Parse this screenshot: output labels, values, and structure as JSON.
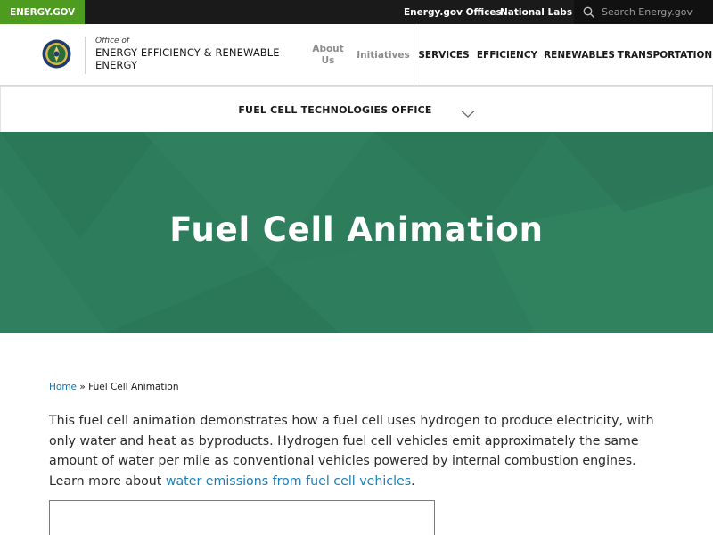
{
  "topbar": {
    "brand": "ENERGY.GOV",
    "offices_link": "Energy.gov Offices",
    "labs_link": "National Labs",
    "search_placeholder": "Search Energy.gov"
  },
  "header": {
    "office_of": "Office of",
    "site_name": "ENERGY EFFICIENCY & RENEWABLE ENERGY",
    "nav": [
      {
        "label": "About Us"
      },
      {
        "label": "Initiatives"
      },
      {
        "label": "SERVICES"
      },
      {
        "label": "EFFICIENCY"
      },
      {
        "label": "RENEWABLES"
      },
      {
        "label": "TRANSPORTATION"
      }
    ]
  },
  "subnav": {
    "label": "FUEL CELL TECHNOLOGIES OFFICE"
  },
  "hero": {
    "title": "Fuel Cell Animation"
  },
  "breadcrumb": {
    "home": "Home",
    "separator": "»",
    "current": "Fuel Cell Animation"
  },
  "intro": {
    "text": "This fuel cell animation demonstrates how a fuel cell uses hydrogen to produce electricity, with only water and heat as byproducts. Hydrogen fuel cell vehicles emit approximately the same amount of water per mile as conventional vehicles powered by internal combustion engines. Learn more about ",
    "link_text": "water emissions from fuel cell vehicles",
    "end": "."
  },
  "colors": {
    "brand_green": "#4d9b1f",
    "hero_green": "#2d7c5c",
    "link_blue": "#1a7fb5",
    "topbar": "#1a1a1a"
  },
  "icons": {
    "search": "search-icon",
    "seal": "doe-seal-icon",
    "chevron": "chevron-down-icon"
  }
}
